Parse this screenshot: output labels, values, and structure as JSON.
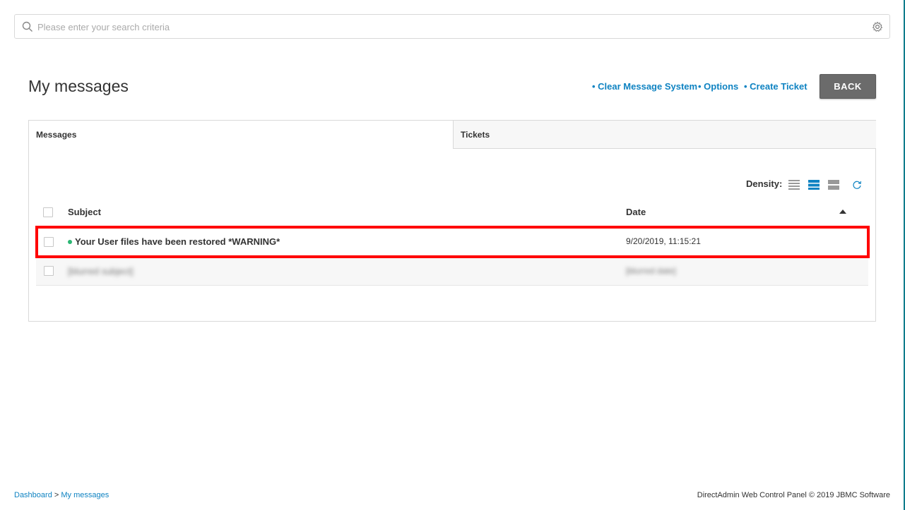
{
  "search": {
    "placeholder": "Please enter your search criteria",
    "value": ""
  },
  "page": {
    "title": "My messages"
  },
  "actions": {
    "clear": "• Clear Message System",
    "options": "• Options",
    "create_ticket": "• Create Ticket",
    "back": "BACK"
  },
  "tabs": [
    {
      "label": "Messages",
      "active": true
    },
    {
      "label": "Tickets",
      "active": false
    }
  ],
  "toolbar": {
    "density_label": "Density:",
    "density_selected": "medium",
    "accent_color": "#0f83c2"
  },
  "table": {
    "columns": [
      "Subject",
      "Date"
    ],
    "sort": "ascending",
    "rows": [
      {
        "subject": "Your User files have been restored *WARNING*",
        "date": "9/20/2019, 11:15:21",
        "unread": true
      },
      {
        "subject": "[blurred subject]",
        "date": "[blurred date]",
        "unread": false
      }
    ]
  },
  "breadcrumb": {
    "dashboard": "Dashboard",
    "separator": " > ",
    "current": "My messages"
  },
  "footer": {
    "text": "DirectAdmin Web Control Panel © 2019 JBMC Software"
  },
  "colors": {
    "link": "#0f83c2",
    "back_button": "#6b6b6b",
    "unread_dot": "#2bb673",
    "highlight": "#ff0000"
  }
}
